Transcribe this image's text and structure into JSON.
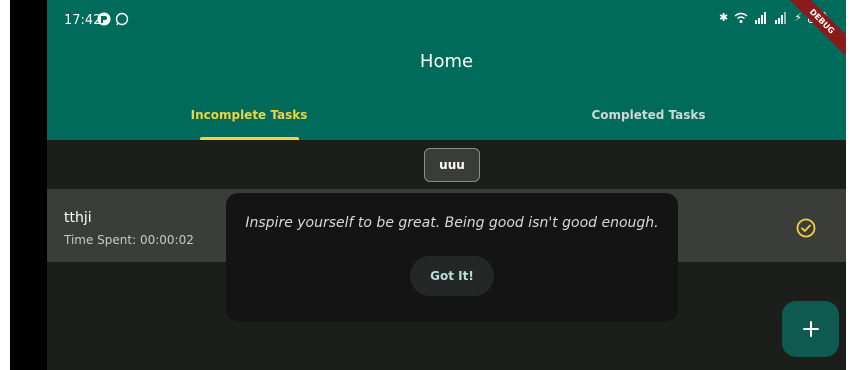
{
  "status_bar": {
    "time": "17:42",
    "debug_label": "DEBUG"
  },
  "app_bar": {
    "title": "Home"
  },
  "tabs": [
    {
      "label": "Incomplete Tasks",
      "selected": true
    },
    {
      "label": "Completed Tasks",
      "selected": false
    }
  ],
  "filter_chip": {
    "label": "uuu"
  },
  "tasks": [
    {
      "name": "tthji",
      "time_spent": "Time Spent: 00:00:02",
      "completed": true
    }
  ],
  "dialog": {
    "message": "Inspire yourself to be great. Being good isn't good enough.",
    "button_label": "Got It!"
  },
  "fab": {
    "icon": "plus-icon"
  },
  "colors": {
    "app_bar": "#006b5b",
    "accent": "#f2d23d",
    "background": "#1c1e1b",
    "task_row": "#3b3d3a",
    "fab": "#0e5a4e"
  }
}
